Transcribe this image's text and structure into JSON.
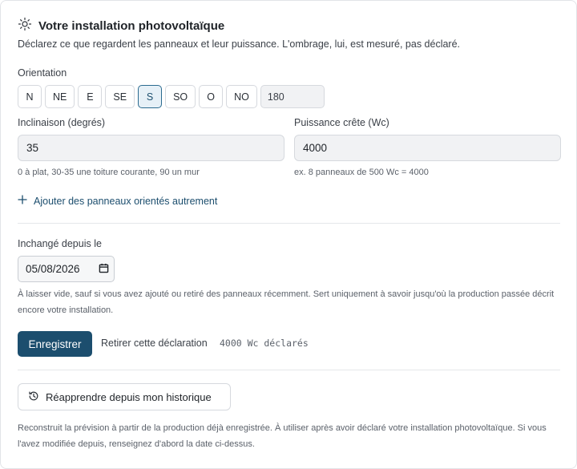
{
  "header": {
    "title": "Votre installation photovoltaïque",
    "subtitle": "Déclarez ce que regardent les panneaux et leur puissance. L'ombrage, lui, est mesuré, pas déclaré."
  },
  "orientation": {
    "label": "Orientation",
    "options": [
      "N",
      "NE",
      "E",
      "SE",
      "S",
      "SO",
      "O",
      "NO"
    ],
    "selected": "S",
    "degrees": "180"
  },
  "inclinaison": {
    "label": "Inclinaison (degrés)",
    "value": "35",
    "hint": "0 à plat, 30-35 une toiture courante, 90 un mur"
  },
  "puissance": {
    "label": "Puissance crête (Wc)",
    "value": "4000",
    "hint": "ex. 8 panneaux de 500 Wc = 4000"
  },
  "add_panels": {
    "label": "Ajouter des panneaux orientés autrement"
  },
  "unchanged": {
    "label": "Inchangé depuis le",
    "date": "05/08/2026",
    "note": "À laisser vide, sauf si vous avez ajouté ou retiré des panneaux récemment. Sert uniquement à savoir jusqu'où la production passée décrit encore votre installation."
  },
  "actions": {
    "save_label": "Enregistrer",
    "remove_label": "Retirer cette déclaration",
    "declared_label": "4000 Wc déclarés"
  },
  "relearn": {
    "label": "Réapprendre depuis mon historique",
    "note": "Reconstruit la prévision à partir de la production déjà enregistrée. À utiliser après avoir déclaré votre installation photovoltaïque. Si vous l'avez modifiée depuis, renseignez d'abord la date ci-dessus."
  },
  "colors": {
    "accent": "#1c4e6e",
    "selected_bg": "#e6f0f7",
    "input_bg": "#f1f2f4",
    "border": "#d6d9de"
  }
}
